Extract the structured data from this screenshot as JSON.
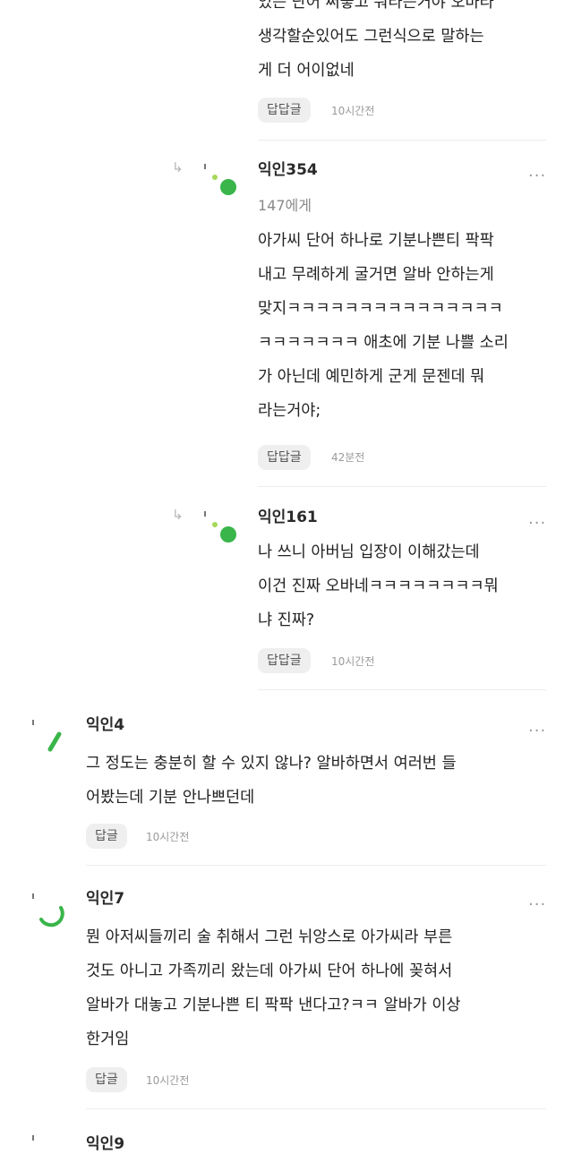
{
  "comments": [
    {
      "author": "",
      "to": "",
      "lines": [
        "있는 단어 써놓고 뭐라는거야 오바라",
        "생각할순있어도 그런식으로 말하는",
        "게 더 어이없네"
      ],
      "reply_label": "답답글",
      "time": "10시간전",
      "more": "...",
      "reply_arrow": ""
    },
    {
      "author": "익인354",
      "to": "147에게",
      "lines": [
        "아가씨 단어 하나로 기분나쁜티 팍팍",
        "내고 무례하게 굴거면 알바 안하는게",
        "맞지ㅋㅋㅋㅋㅋㅋㅋㅋㅋㅋㅋㅋㅋㅋㅋ",
        "ㅋㅋㅋㅋㅋㅋㅋ 애초에 기분 나쁠 소리",
        "가 아닌데 예민하게 군게 문젠데 뭐",
        "라는거야;"
      ],
      "reply_label": "답답글",
      "time": "42분전",
      "more": "...",
      "reply_arrow": "↳"
    },
    {
      "author": "익인161",
      "to": "",
      "lines": [
        "나 쓰니 아버님 입장이 이해갔는데",
        "이건 진짜 오바네ㅋㅋㅋㅋㅋㅋㅋㅋ뭐",
        "냐 진짜?"
      ],
      "reply_label": "답답글",
      "time": "10시간전",
      "more": "...",
      "reply_arrow": "↳"
    },
    {
      "author": "익인4",
      "to": "",
      "lines": [
        "그 정도는 충분히 할 수 있지 않나? 알바하면서 여러번 들",
        "어봤는데 기분 안나쁘던데"
      ],
      "reply_label": "답글",
      "time": "10시간전",
      "more": "...",
      "reply_arrow": ""
    },
    {
      "author": "익인7",
      "to": "",
      "lines": [
        "뭔 아저씨들끼리 술 취해서 그런 뉘앙스로 아가씨라 부른",
        "것도 아니고 가족끼리 왔는데 아가씨 단어 하나에 꽂혀서",
        "알바가 대놓고 기분나쁜 티 팍팍 낸다고?ㅋㅋ 알바가 이상",
        "한거임"
      ],
      "reply_label": "답글",
      "time": "10시간전",
      "more": "...",
      "reply_arrow": ""
    },
    {
      "author": "익인9",
      "to": "",
      "lines": [],
      "reply_label": "",
      "time": "",
      "more": "",
      "reply_arrow": ""
    }
  ],
  "colors": {
    "accent_green": "#39b54a",
    "avatar_gray": "#777777"
  }
}
